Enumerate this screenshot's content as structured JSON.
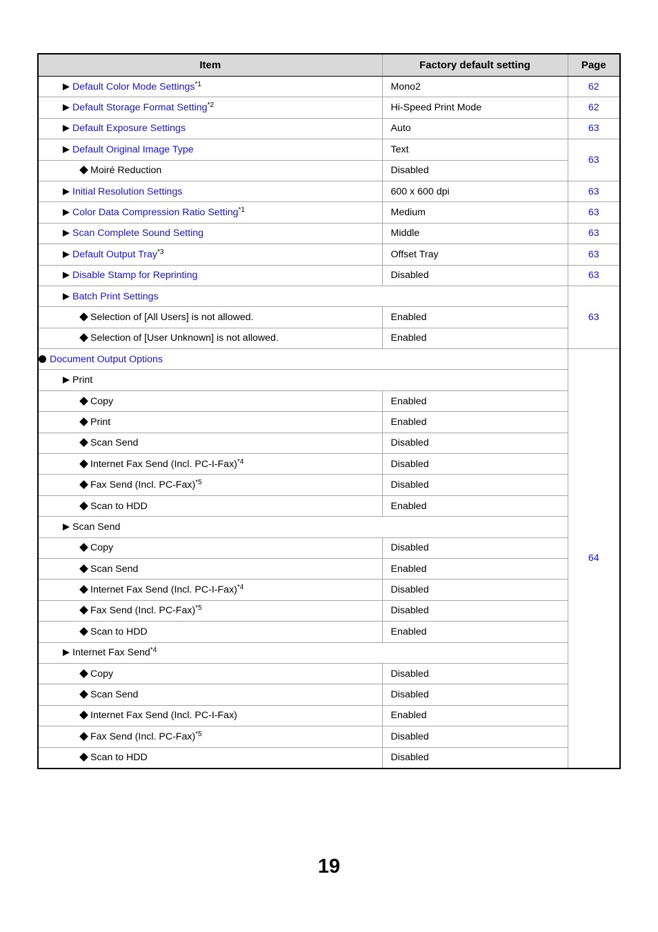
{
  "table": {
    "headers": {
      "item": "Item",
      "default": "Factory default setting",
      "page": "Page"
    },
    "rows": [
      {
        "level": 1,
        "marker": "triangle",
        "label": "Default Color Mode Settings",
        "note": "*1",
        "link": true,
        "default": "Mono2",
        "page": "62"
      },
      {
        "level": 1,
        "marker": "triangle",
        "label": "Default Storage Format Setting",
        "note": "*2",
        "link": true,
        "default": "Hi-Speed Print Mode",
        "page": "62"
      },
      {
        "level": 1,
        "marker": "triangle",
        "label": "Default Exposure Settings",
        "note": "",
        "link": true,
        "default": "Auto",
        "page": "63"
      },
      {
        "level": 1,
        "marker": "triangle",
        "label": "Default Original Image Type",
        "note": "",
        "link": true,
        "default": "Text",
        "page": "63",
        "pageSpan": 2
      },
      {
        "level": 2,
        "marker": "diamond",
        "label": "Moiré Reduction",
        "note": "",
        "link": false,
        "default": "Disabled"
      },
      {
        "level": 1,
        "marker": "triangle",
        "label": "Initial Resolution Settings",
        "note": "",
        "link": true,
        "default": "600 x 600 dpi",
        "page": "63"
      },
      {
        "level": 1,
        "marker": "triangle",
        "label": "Color Data Compression Ratio Setting",
        "note": "*1",
        "link": true,
        "default": "Medium",
        "page": "63"
      },
      {
        "level": 1,
        "marker": "triangle",
        "label": "Scan Complete Sound Setting",
        "note": "",
        "link": true,
        "default": "Middle",
        "page": "63"
      },
      {
        "level": 1,
        "marker": "triangle",
        "label": "Default Output Tray",
        "note": "*3",
        "link": true,
        "default": "Offset Tray",
        "page": "63"
      },
      {
        "level": 1,
        "marker": "triangle",
        "label": "Disable Stamp for Reprinting",
        "note": "",
        "link": true,
        "default": "Disabled",
        "page": "63"
      },
      {
        "level": 1,
        "marker": "triangle",
        "label": "Batch Print Settings",
        "note": "",
        "link": true,
        "span": true,
        "page": "63",
        "pageSpan": 3
      },
      {
        "level": 2,
        "marker": "diamond",
        "label": "Selection of [All Users] is not allowed.",
        "note": "",
        "link": false,
        "default": "Enabled"
      },
      {
        "level": 2,
        "marker": "diamond",
        "label": "Selection of [User Unknown] is not allowed.",
        "note": "",
        "link": false,
        "default": "Enabled"
      },
      {
        "level": 0,
        "marker": "circle",
        "label": "Document Output Options",
        "note": "",
        "link": true,
        "span": true,
        "page": "64",
        "pageSpan": 20
      },
      {
        "level": 1,
        "marker": "triangle",
        "label": "Print",
        "note": "",
        "link": false,
        "span": true
      },
      {
        "level": 2,
        "marker": "diamond",
        "label": "Copy",
        "note": "",
        "link": false,
        "default": "Enabled"
      },
      {
        "level": 2,
        "marker": "diamond",
        "label": "Print",
        "note": "",
        "link": false,
        "default": "Enabled"
      },
      {
        "level": 2,
        "marker": "diamond",
        "label": "Scan Send",
        "note": "",
        "link": false,
        "default": "Disabled"
      },
      {
        "level": 2,
        "marker": "diamond",
        "label": "Internet Fax Send (Incl. PC-I-Fax)",
        "note": "*4",
        "link": false,
        "default": "Disabled"
      },
      {
        "level": 2,
        "marker": "diamond",
        "label": "Fax Send (Incl. PC-Fax)",
        "note": "*5",
        "link": false,
        "default": "Disabled"
      },
      {
        "level": 2,
        "marker": "diamond",
        "label": "Scan to HDD",
        "note": "",
        "link": false,
        "default": "Enabled"
      },
      {
        "level": 1,
        "marker": "triangle",
        "label": "Scan Send",
        "note": "",
        "link": false,
        "span": true
      },
      {
        "level": 2,
        "marker": "diamond",
        "label": "Copy",
        "note": "",
        "link": false,
        "default": "Disabled"
      },
      {
        "level": 2,
        "marker": "diamond",
        "label": "Scan Send",
        "note": "",
        "link": false,
        "default": "Enabled"
      },
      {
        "level": 2,
        "marker": "diamond",
        "label": "Internet Fax Send (Incl. PC-I-Fax)",
        "note": "*4",
        "link": false,
        "default": "Disabled"
      },
      {
        "level": 2,
        "marker": "diamond",
        "label": "Fax Send (Incl. PC-Fax)",
        "note": "*5",
        "link": false,
        "default": "Disabled"
      },
      {
        "level": 2,
        "marker": "diamond",
        "label": "Scan to HDD",
        "note": "",
        "link": false,
        "default": "Enabled"
      },
      {
        "level": 1,
        "marker": "triangle",
        "label": "Internet Fax Send",
        "note": "*4",
        "link": false,
        "span": true
      },
      {
        "level": 2,
        "marker": "diamond",
        "label": "Copy",
        "note": "",
        "link": false,
        "default": "Disabled"
      },
      {
        "level": 2,
        "marker": "diamond",
        "label": "Scan Send",
        "note": "",
        "link": false,
        "default": "Disabled"
      },
      {
        "level": 2,
        "marker": "diamond",
        "label": "Internet Fax Send (Incl. PC-I-Fax)",
        "note": "",
        "link": false,
        "default": "Enabled"
      },
      {
        "level": 2,
        "marker": "diamond",
        "label": "Fax Send (Incl. PC-Fax)",
        "note": "*5",
        "link": false,
        "default": "Disabled"
      },
      {
        "level": 2,
        "marker": "diamond",
        "label": "Scan to HDD",
        "note": "",
        "link": false,
        "default": "Disabled"
      }
    ]
  },
  "colors": {
    "link": "#1414e6",
    "header_bg": "#d9d9d9",
    "grid": "#a6a6a6"
  },
  "page_number": "19"
}
